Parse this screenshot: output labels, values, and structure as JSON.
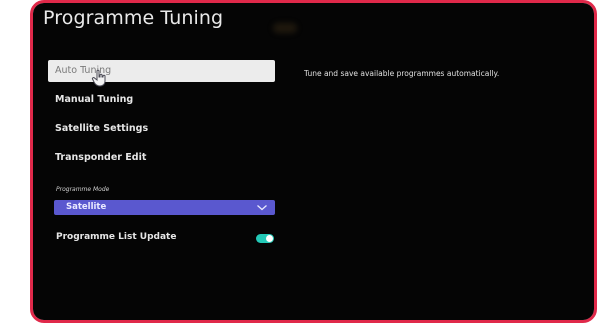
{
  "screen": {
    "title": "Programme Tuning",
    "description": "Tune and save available programmes automatically."
  },
  "menu": {
    "items": [
      {
        "label": "Auto Tuning",
        "selected": true
      },
      {
        "label": "Manual Tuning",
        "selected": false
      },
      {
        "label": "Satellite Settings",
        "selected": false
      },
      {
        "label": "Transponder Edit",
        "selected": false
      }
    ],
    "programme_mode": {
      "label": "Programme Mode",
      "value": "Satellite"
    },
    "list_update": {
      "label": "Programme List Update",
      "enabled": true
    }
  },
  "colors": {
    "frame_border": "#e0294a",
    "selected_item_bg": "#ececec",
    "dropdown_bg": "#5a58cf",
    "toggle_on": "#23c9b7",
    "screen_bg": "#050505"
  },
  "icons": {
    "cursor": "pointer-hand-icon",
    "dropdown": "chevron-down-icon"
  }
}
